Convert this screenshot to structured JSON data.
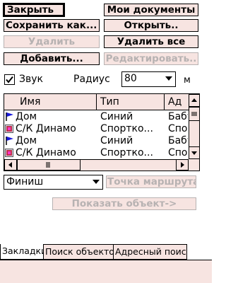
{
  "buttons": {
    "close": "Закрыть",
    "my_documents": "Мои документы",
    "save_as": "Сохранить как...",
    "open": "Открыть..",
    "delete": "Удалить",
    "delete_all": "Удалить все",
    "add": "Добавить...",
    "edit": "Редактировать..",
    "route_point": "Точка маршрута",
    "show_object": "Показать объект->"
  },
  "sound": {
    "label": "Звук",
    "checked": true
  },
  "radius": {
    "label": "Радиус",
    "value": "80",
    "unit": "м"
  },
  "list": {
    "columns": [
      "Имя",
      "Тип",
      "Ад"
    ],
    "rows": [
      {
        "name": "Дом",
        "type": "Синий",
        "addr": "Бабу",
        "icon": "blue-flag-icon"
      },
      {
        "name": "С/К Динамо",
        "type": "Спортко...",
        "addr": "Спор",
        "icon": "red-marker-icon"
      },
      {
        "name": "Дом",
        "type": "Синий",
        "addr": "Бабу",
        "icon": "blue-flag-icon"
      },
      {
        "name": "С/К Динамо",
        "type": "Спортко...",
        "addr": "Спор",
        "icon": "red-marker-icon"
      }
    ]
  },
  "target_select": {
    "value": "Финиш"
  },
  "tabs": [
    "Закладки",
    "Поиск объектов",
    "Адресный поиск"
  ],
  "colors": {
    "button_bg": "#f7e4e1",
    "disabled_text": "#b7b2b2",
    "flag_blue": "#1a1adb",
    "marker_red": "#c0304a"
  }
}
